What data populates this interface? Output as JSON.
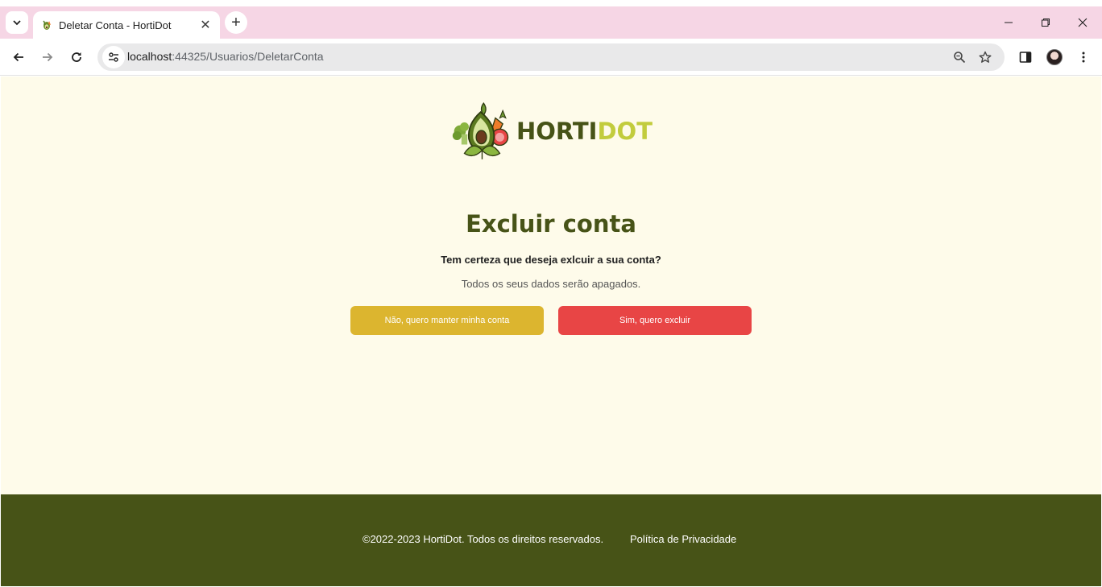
{
  "browser": {
    "tab_title": "Deletar Conta - HortiDot",
    "url_host": "localhost",
    "url_path": ":44325/Usuarios/DeletarConta",
    "tab_close_glyph": "✕",
    "new_tab_glyph": "+"
  },
  "page": {
    "logo": {
      "part1": "HORTI",
      "part2": "DOT"
    },
    "title": "Excluir conta",
    "question": "Tem certeza que deseja exlcuir a sua conta?",
    "note": "Todos os seus dados serão apagados.",
    "keep_button": "Não, quero manter minha conta",
    "delete_button": "Sim, quero excluir"
  },
  "footer": {
    "copyright": "©2022-2023 HortiDot. Todos os direitos reservados.",
    "privacy_link": "Política de Privacidade"
  },
  "colors": {
    "brand_dark": "#475317",
    "brand_light": "#c2cc3d",
    "keep_button": "#dcb52f",
    "delete_button": "#e84545",
    "page_bg": "#fefbea",
    "tabbar_bg": "#f6d6e5"
  },
  "icons": [
    "tab-list-icon",
    "favicon-icon",
    "close-icon",
    "plus-icon",
    "minimize-icon",
    "restore-icon",
    "window-close-icon",
    "back-icon",
    "forward-icon",
    "reload-icon",
    "site-info-icon",
    "zoom-icon",
    "bookmark-star-icon",
    "side-panel-icon",
    "profile-avatar",
    "more-menu-icon",
    "hortidot-logo-icon"
  ]
}
